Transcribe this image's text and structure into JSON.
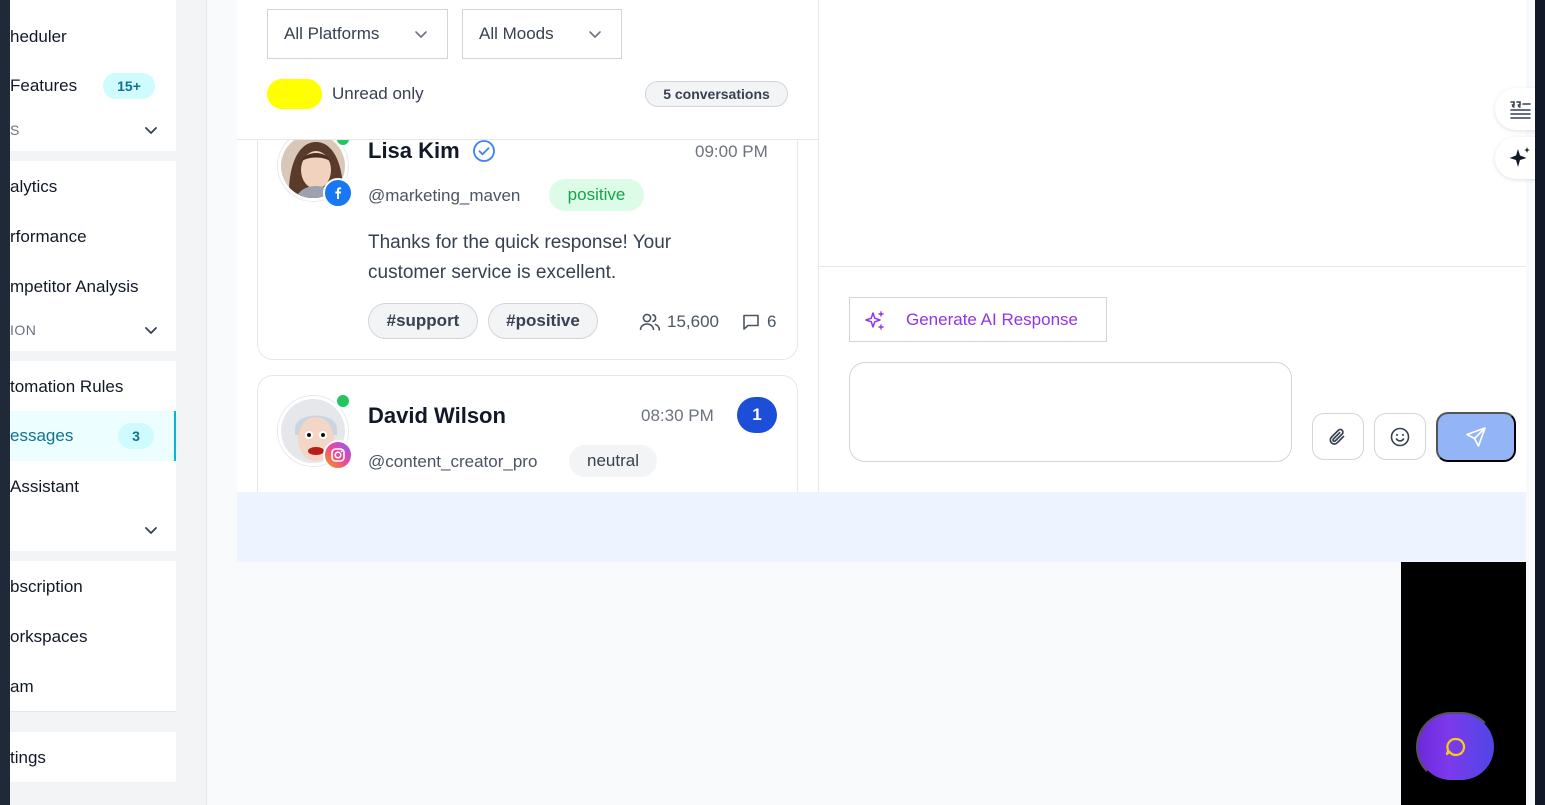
{
  "sidebar": {
    "items": [
      {
        "label": "heduler"
      },
      {
        "label": " Features",
        "badge": "15+"
      },
      {
        "label": "alytics"
      },
      {
        "label": "rformance"
      },
      {
        "label": "mpetitor Analysis"
      },
      {
        "label": "tomation Rules"
      },
      {
        "label": "essages",
        "badge": "3"
      },
      {
        "label": " Assistant"
      },
      {
        "label": "bscription"
      },
      {
        "label": "orkspaces"
      },
      {
        "label": "am"
      },
      {
        "label": "tings"
      }
    ],
    "sections": [
      {
        "label": "S"
      },
      {
        "label": "ION"
      },
      {
        "label": ""
      }
    ]
  },
  "filters": {
    "platform": "All Platforms",
    "mood": "All Moods",
    "unread_label": "Unread only",
    "count": "5 conversations"
  },
  "conversations": [
    {
      "name": "Lisa Kim",
      "verified": true,
      "handle": "@marketing_maven",
      "mood": "positive",
      "time": "09:00 PM",
      "platform": "facebook",
      "message": "Thanks for the quick response! Your customer service is excellent.",
      "tags": [
        "#support",
        "#positive"
      ],
      "followers": "15,600",
      "comments": "6"
    },
    {
      "name": "David Wilson",
      "handle": "@content_creator_pro",
      "mood": "neutral",
      "time": "08:30 PM",
      "platform": "instagram",
      "unread": "1"
    }
  ],
  "chat": {
    "ai_button": "Generate AI Response",
    "reply_placeholder": ""
  },
  "colors": {
    "accent": "#06b6d4",
    "primary": "#1d4ed8",
    "ai_purple": "#9333ea",
    "positive_bg": "#dcfce7",
    "positive_text": "#16a34a",
    "toggle": "#ffff00"
  },
  "icons": {
    "sidebar_chevron": "chevron-down-icon",
    "verified": "verified-check-icon",
    "followers": "users-icon",
    "comments": "comment-icon",
    "attach": "paperclip-icon",
    "emoji": "smile-icon",
    "send": "send-icon",
    "ai": "sparkles-icon",
    "fab": "chat-bubble-icon",
    "side_tab_1": "quote-lines-icon",
    "side_tab_2": "sparkle-icon"
  }
}
